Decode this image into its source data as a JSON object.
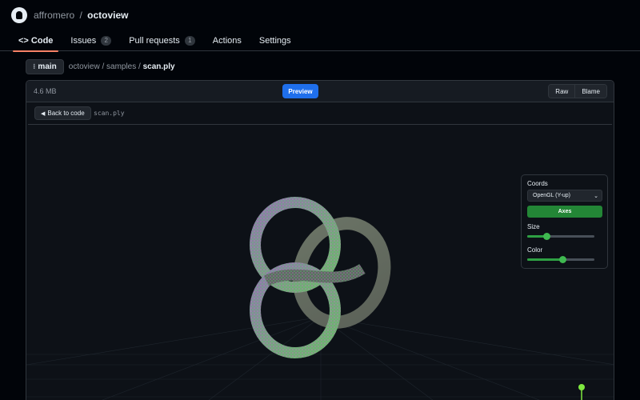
{
  "header": {
    "owner": "affromero",
    "separator": "/",
    "repo": "octoview"
  },
  "tabs": [
    {
      "label": "<> Code",
      "active": true
    },
    {
      "label": "Issues",
      "count": "2"
    },
    {
      "label": "Pull requests",
      "count": "1"
    },
    {
      "label": "Actions"
    },
    {
      "label": "Settings"
    }
  ],
  "pathbar": {
    "branch": "main",
    "path_prefix": "octoview / samples / ",
    "file": "scan.ply"
  },
  "file": {
    "size": "4.6 MB",
    "preview_label": "Preview",
    "raw_label": "Raw",
    "blame_label": "Blame"
  },
  "viewer": {
    "back_label": "Back to code",
    "filename": "scan.ply",
    "coords_label": "Coords",
    "coords_value": "OpenGL (Y-up)",
    "axes_label": "Axes",
    "size_label": "Size",
    "size_level": 0.28,
    "color_label": "Color",
    "color_level": 0.52
  },
  "colors": {
    "accent": "#1f6feb",
    "green": "#238636",
    "tab_underline": "#f78166",
    "axis_y": "#7ee83f"
  }
}
